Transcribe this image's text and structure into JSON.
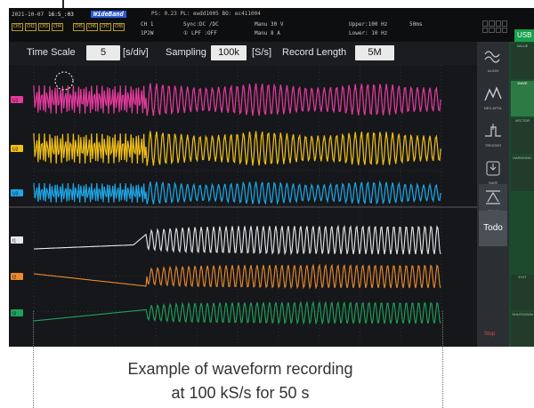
{
  "status": {
    "date": "2021-10-07",
    "time": "16:5_:03",
    "band": "WideBand",
    "ps": "PS: 0.23  PL: ewdd1005  BO: ec411004",
    "channel_tags": [
      "CH1",
      "CH2",
      "CH3",
      "CH4",
      "CH5",
      "CH6",
      "CH7",
      "CH8"
    ],
    "ch": "CH 1",
    "wiring": "1P2W",
    "sync": "Sync:DC  /DC",
    "lpf": "① LPF :OFF",
    "manu_voltage": "Manu  30 V",
    "manu_current": "Manu   8 A",
    "upper": "Upper:100 Hz",
    "lower": "Lower: 10 Hz",
    "interval": "50ms",
    "usb": "USB"
  },
  "settings": {
    "time_scale_label": "Time Scale",
    "time_scale_value": "5",
    "time_scale_unit": "[s/div]",
    "sampling_label": "Sampling",
    "sampling_value": "100k",
    "sampling_unit": "[S/s]",
    "record_length_label": "Record Length",
    "record_length_value": "5M"
  },
  "side_menu": [
    {
      "label": "ALIGN",
      "icon": "align-icon"
    },
    {
      "label": "NEG.&POL",
      "icon": "waveform-icon"
    },
    {
      "label": "TRIGGER",
      "icon": "trigger-icon"
    },
    {
      "label": "SAVE",
      "icon": "save-icon"
    },
    {
      "label": "SCALE",
      "icon": "scale-icon"
    }
  ],
  "todo_label": "Todo",
  "stop_label": "Stop",
  "side_tabs": [
    {
      "label": "VALUE",
      "active": false
    },
    {
      "label": "WAVE",
      "active": true
    },
    {
      "label": "VECTOR",
      "active": false
    },
    {
      "label": "HARMONIC",
      "active": false
    },
    {
      "label": "EXIT",
      "active": false
    },
    {
      "label": "SHUTDOWN",
      "active": false
    }
  ],
  "channel_labels": [
    "U1",
    "U2",
    "U3",
    "I1",
    "I2",
    "I3"
  ],
  "trace_colors": [
    "#e63a9e",
    "#f2c018",
    "#1ea7e6",
    "#e8e8e8",
    "#ec8a2c",
    "#1fa35a"
  ],
  "caption_line1": "Example of waveform recording",
  "caption_line2": "at 100 kS/s for 50 s"
}
